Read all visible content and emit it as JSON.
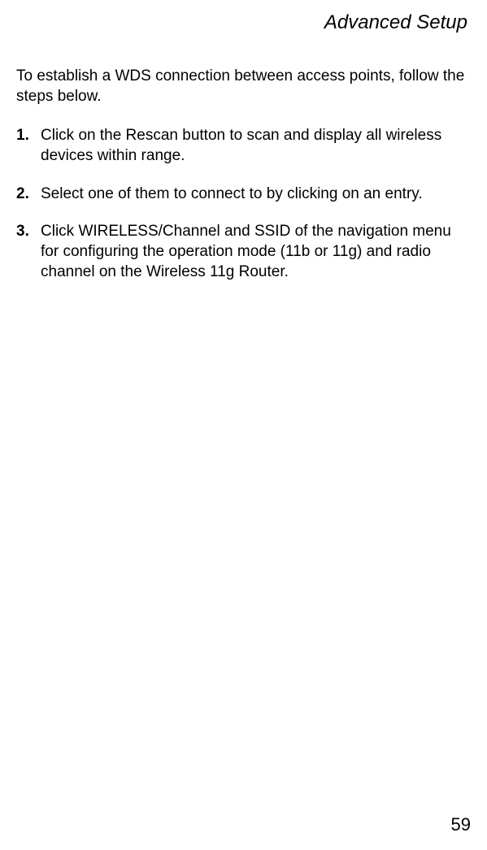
{
  "header": {
    "title": "Advanced Setup"
  },
  "intro": "To establish a WDS connection between access points, follow the steps below.",
  "steps": [
    {
      "number": "1.",
      "text": "Click on the Rescan button to scan and display all wireless devices within range."
    },
    {
      "number": "2.",
      "text": "Select one of them to connect to by clicking on an entry."
    },
    {
      "number": "3.",
      "text": "Click WIRELESS/Channel and SSID of the navigation menu for configuring the operation mode (11b or 11g) and radio channel on the Wireless 11g Router."
    }
  ],
  "page_number": "59"
}
